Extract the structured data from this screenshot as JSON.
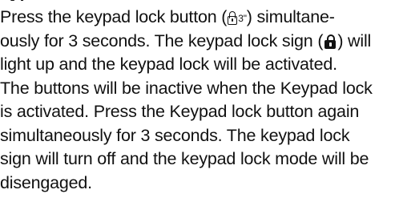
{
  "section": {
    "heading_fragment": "eypad",
    "lines": [
      {
        "a": "Press the keypad lock button (",
        "glyph_text": "3\"",
        "b": ") simultane-"
      },
      {
        "a": "ously for 3 seconds. The keypad lock sign (",
        "b": ") will"
      },
      {
        "text": "light up and the keypad lock will be activated."
      },
      {
        "text": "The buttons will be inactive when the Keypad lock"
      },
      {
        "text": "is activated. Press the Keypad lock button again"
      },
      {
        "text": "simultaneously for 3 seconds. The keypad lock"
      },
      {
        "text": "sign will turn off and the keypad lock mode will be"
      },
      {
        "text": "disengaged."
      }
    ]
  },
  "icons": {
    "button_icon": "lock-outline-icon",
    "sign_icon": "lock-filled-icon"
  }
}
